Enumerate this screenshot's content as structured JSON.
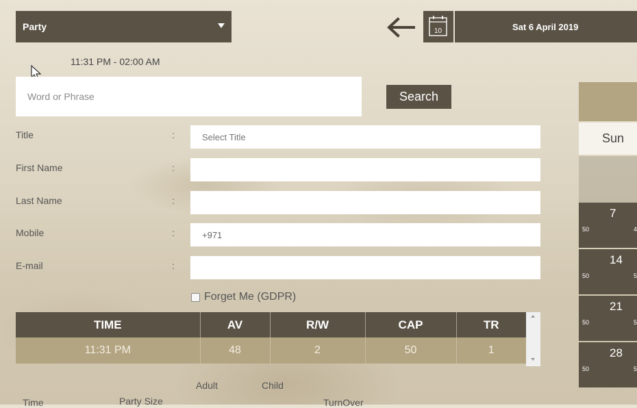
{
  "party_select": {
    "value": "Party"
  },
  "date_bar": {
    "back_icon": "arrow-left-icon",
    "calendar_icon": "calendar-icon",
    "calendar_day": "10",
    "date": "Sat 6 April 2019"
  },
  "time_range": "11:31 PM - 02:00 AM",
  "search": {
    "placeholder": "Word or Phrase",
    "button": "Search"
  },
  "form": {
    "colon": ":",
    "title": {
      "label": "Title",
      "placeholder": "Select Title"
    },
    "first_name": {
      "label": "First Name",
      "value": ""
    },
    "last_name": {
      "label": "Last Name",
      "value": ""
    },
    "mobile": {
      "label": "Mobile",
      "value": "+971"
    },
    "email": {
      "label": "E-mail",
      "value": ""
    },
    "gdpr": "Forget Me (GDPR)"
  },
  "table": {
    "headers": [
      "TIME",
      "AV",
      "R/W",
      "CAP",
      "TR"
    ],
    "rows": [
      [
        "11:31 PM",
        "48",
        "2",
        "50",
        "1"
      ]
    ]
  },
  "bottom_labels": {
    "adult": "Adult",
    "child": "Child",
    "time": "Time",
    "party_size": "Party Size",
    "turnover": "TurnOver"
  },
  "calendar": {
    "day_header": "Sun",
    "days": [
      {
        "num": "7",
        "count": "50",
        "count2": "4"
      },
      {
        "num": "14",
        "count": "50",
        "count2": "5"
      },
      {
        "num": "21",
        "count": "50",
        "count2": "5"
      },
      {
        "num": "28",
        "count": "50",
        "count2": "5"
      }
    ]
  },
  "colors": {
    "dark": "#5a5245",
    "tan": "#b3a482",
    "background": "#ddd5c2"
  }
}
